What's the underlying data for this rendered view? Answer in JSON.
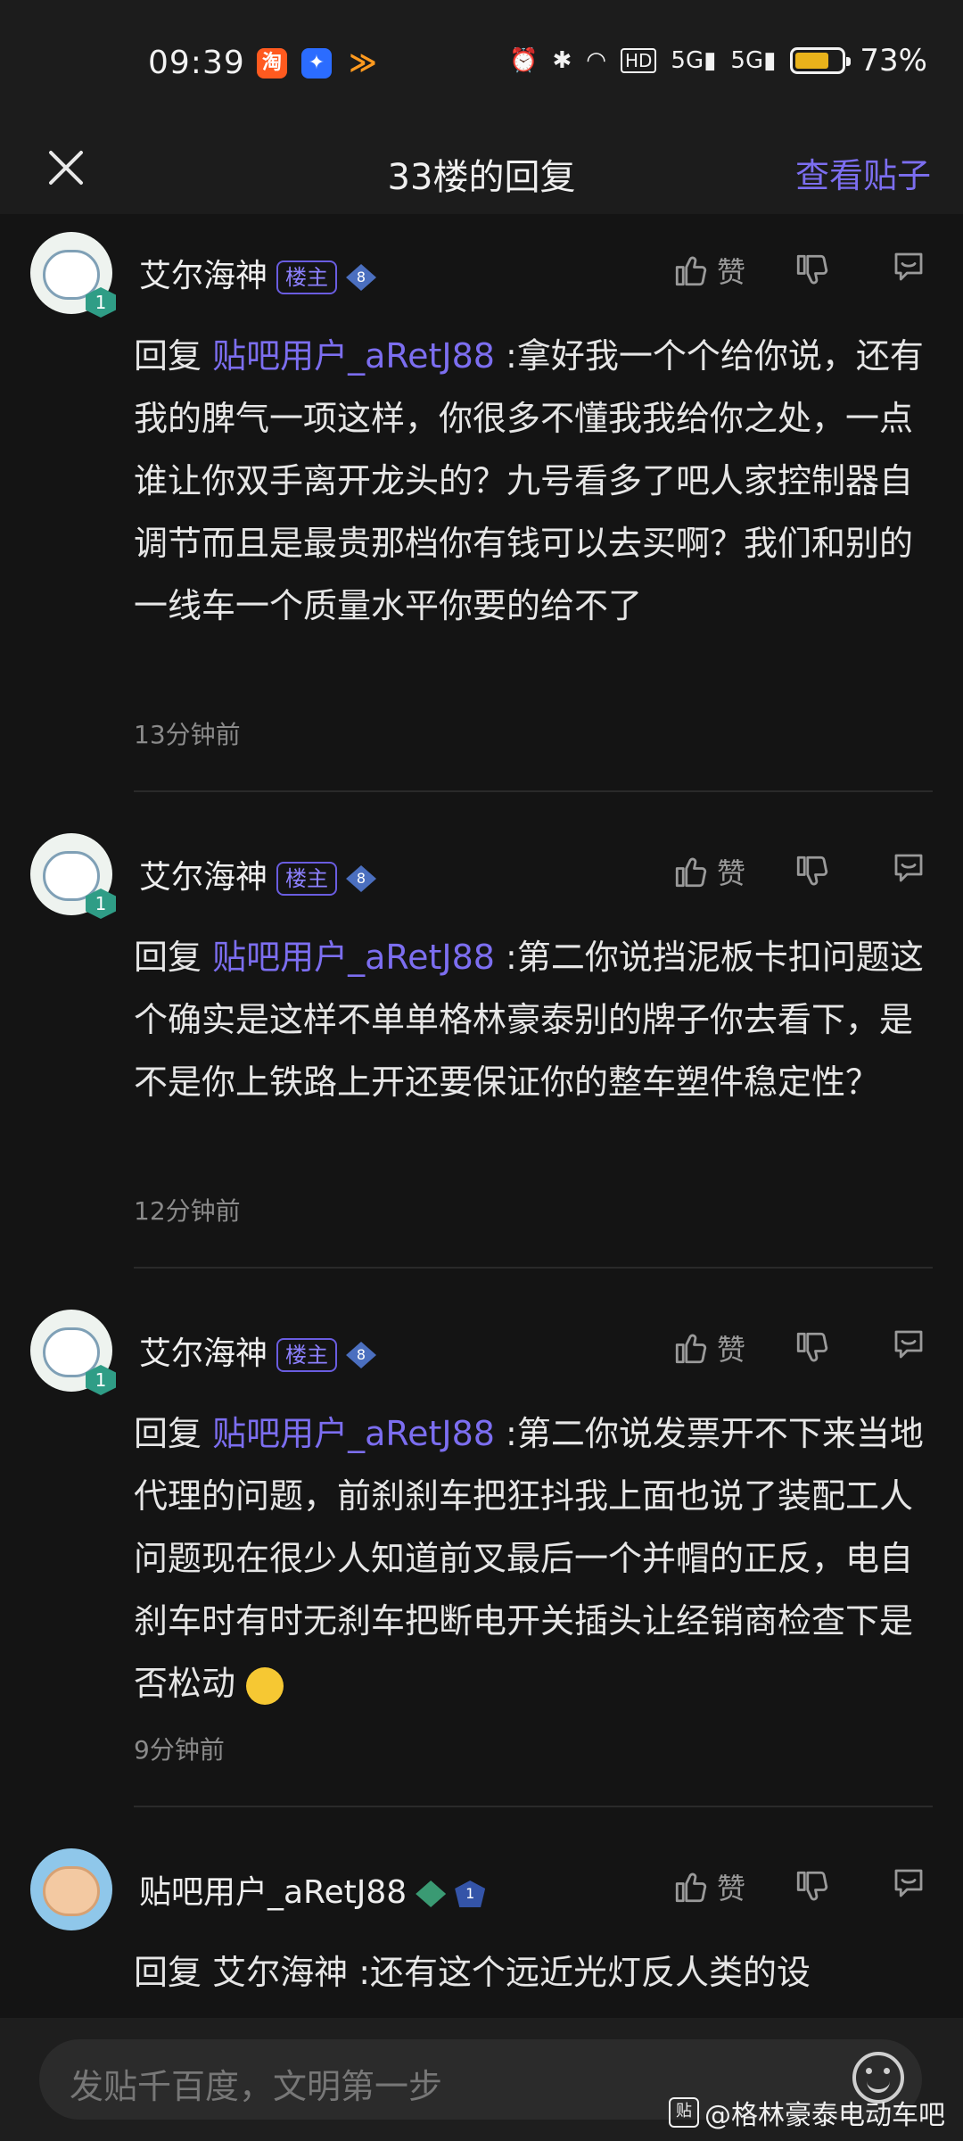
{
  "status_bar": {
    "time": "09:39",
    "app_icons": [
      "taobao-icon",
      "telecom-icon",
      "app-icon"
    ],
    "app_icon_glyphs": [
      "淘",
      "✦",
      "≫"
    ],
    "system_icons": [
      "alarm-icon",
      "bluetooth-icon",
      "wifi-icon",
      "hd-icon",
      "signal-5g-icon",
      "signal-5g-icon"
    ],
    "battery_percent": "73%",
    "battery_level": 0.73,
    "battery_color": "#e8b21b"
  },
  "header": {
    "title": "33楼的回复",
    "view_post_label": "查看贴子"
  },
  "posts": [
    {
      "username": "艾尔海神",
      "tag": "楼主",
      "gem_level": "8",
      "avatar_level": "1",
      "like_label": "赞",
      "reply_prefix": "回复",
      "mention": "贴吧用户_aRetJ88",
      "text": " :拿好我一个个给你说，还有我的脾气一项这样，你很多不懂我我给你之处，一点谁让你双手离开龙头的？九号看多了吧人家控制器自调节而且是最贵那档你有钱可以去买啊？我们和别的一线车一个质量水平你要的给不了",
      "time": "13分钟前"
    },
    {
      "username": "艾尔海神",
      "tag": "楼主",
      "gem_level": "8",
      "avatar_level": "1",
      "like_label": "赞",
      "reply_prefix": "回复",
      "mention": "贴吧用户_aRetJ88",
      "text": " :第二你说挡泥板卡扣问题这个确实是这样不单单格林豪泰别的牌子你去看下，是不是你上铁路上开还要保证你的整车塑件稳定性？",
      "time": "12分钟前"
    },
    {
      "username": "艾尔海神",
      "tag": "楼主",
      "gem_level": "8",
      "avatar_level": "1",
      "like_label": "赞",
      "reply_prefix": "回复",
      "mention": "贴吧用户_aRetJ88",
      "text": " :第二你说发票开不下来当地代理的问题，前刹刹车把狂抖我上面也说了装配工人问题现在很少人知道前叉最后一个并帽的正反，电自刹车时有时无刹车把断电开关插头让经销商检查下是否松动 ",
      "emoji": "smile-emoji",
      "time": "9分钟前"
    },
    {
      "username": "贴吧用户_aRetJ88",
      "gem_level": "",
      "avatar_level": "1",
      "like_label": "赞",
      "reply_prefix": "回复",
      "mention": "艾尔海神",
      "text": " :还有这个远近光灯反人类的设"
    }
  ],
  "input": {
    "placeholder": "发贴千百度，文明第一步"
  },
  "watermark": {
    "badge": "贴",
    "text": "@格林豪泰电动车吧"
  }
}
